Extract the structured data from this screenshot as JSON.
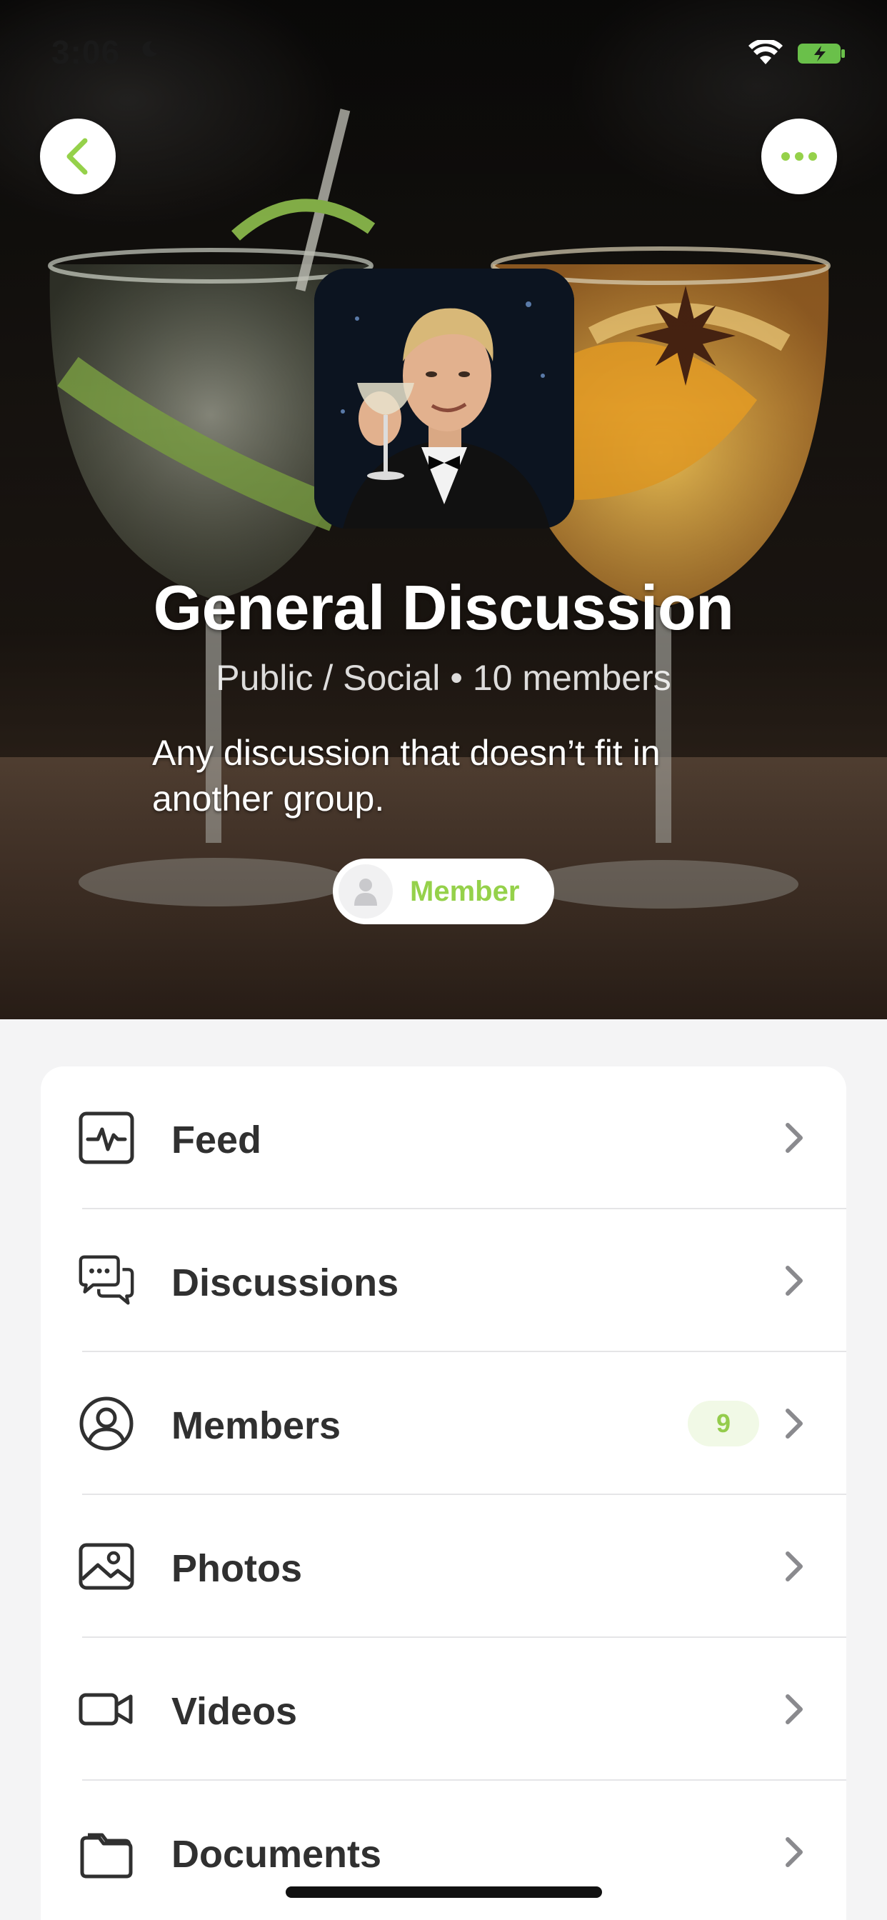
{
  "status_bar": {
    "time": "3:06"
  },
  "colors": {
    "accent": "#95d14a",
    "badge_bg": "#f1f9e6",
    "text_dark": "#303030",
    "chevron": "#8a8a8e"
  },
  "header": {
    "back_icon": "chevron-left-icon",
    "more_icon": "more-dots-icon"
  },
  "group": {
    "title": "General Discussion",
    "type": "Public / Social",
    "separator": "•",
    "members_count": "10 members",
    "description": "Any discussion that doesn’t fit in another group.",
    "membership_label": "Member"
  },
  "menu": {
    "items": [
      {
        "label": "Feed",
        "icon": "activity-icon"
      },
      {
        "label": "Discussions",
        "icon": "chat-bubbles-icon"
      },
      {
        "label": "Members",
        "icon": "user-circle-icon",
        "badge": "9"
      },
      {
        "label": "Photos",
        "icon": "photo-icon"
      },
      {
        "label": "Videos",
        "icon": "video-camera-icon"
      },
      {
        "label": "Documents",
        "icon": "folder-icon"
      }
    ]
  }
}
